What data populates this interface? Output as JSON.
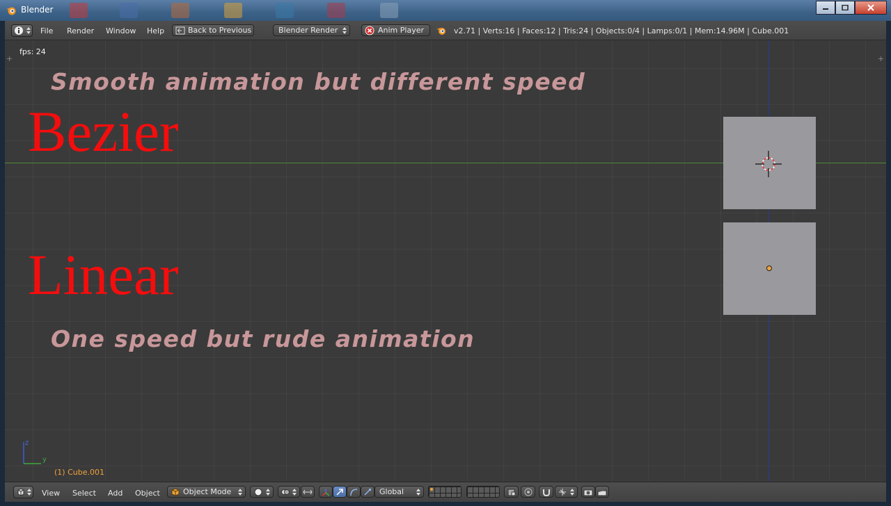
{
  "window": {
    "title": "Blender"
  },
  "info_header": {
    "menus": [
      "File",
      "Render",
      "Window",
      "Help"
    ],
    "back_button": "Back to Previous",
    "render_engine": "Blender Render",
    "anim_player": "Anim Player",
    "stats": "v2.71 | Verts:16 | Faces:12 | Tris:24 | Objects:0/4 | Lamps:0/1 | Mem:14.96M | Cube.001"
  },
  "viewport": {
    "fps": "fps: 24",
    "caption_top": "Smooth animation but different speed",
    "word_bezier": "Bezier",
    "word_linear": "Linear",
    "caption_bottom": "One speed but rude animation",
    "active_object": "(1) Cube.001",
    "axes_labels": {
      "z": "z",
      "y": "y"
    }
  },
  "view_header": {
    "menus": [
      "View",
      "Select",
      "Add",
      "Object"
    ],
    "mode": "Object Mode",
    "orientation": "Global"
  },
  "colors": {
    "viewport_bg": "#393939",
    "big_text": "#f50d0d",
    "caption": "#c8979a",
    "cube": "#9a9a9e",
    "x_axis": "#4e8a3a",
    "z_axis": "#2b3a8f",
    "active_label": "#f0a23c"
  }
}
